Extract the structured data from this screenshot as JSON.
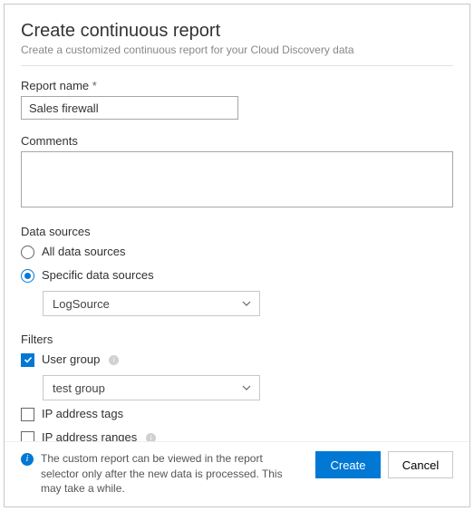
{
  "header": {
    "title": "Create continuous report",
    "subtitle": "Create a customized continuous report for your Cloud Discovery data"
  },
  "fields": {
    "report_name_label": "Report name",
    "report_name_value": "Sales firewall",
    "comments_label": "Comments",
    "comments_value": ""
  },
  "data_sources": {
    "label": "Data sources",
    "options": {
      "all": "All data sources",
      "specific": "Specific data sources"
    },
    "selected": "specific",
    "dropdown_value": "LogSource"
  },
  "filters": {
    "label": "Filters",
    "user_group": {
      "label": "User group",
      "checked": true,
      "dropdown_value": "test group"
    },
    "ip_tags": {
      "label": "IP address tags",
      "checked": false
    },
    "ip_ranges": {
      "label": "IP address ranges",
      "checked": false
    }
  },
  "footer": {
    "info_text": "The custom report can be viewed in the report selector only after the new data is processed.\nThis may take a while.",
    "create": "Create",
    "cancel": "Cancel"
  }
}
